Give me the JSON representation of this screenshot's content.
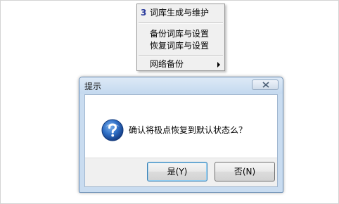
{
  "menu": {
    "items": [
      {
        "number": "3",
        "label": "词库生成与维护"
      },
      {
        "label": "备份词库与设置"
      },
      {
        "label": "恢复词库与设置"
      },
      {
        "label": "网络备份"
      }
    ]
  },
  "dialog": {
    "title": "提示",
    "message": "确认将极点恢复到默认状态么？",
    "buttons": {
      "yes": "是(Y)",
      "no": "否(N)"
    }
  },
  "icons": {
    "question": "question-icon",
    "close": "close-icon",
    "submenu": "submenu-arrow-icon"
  },
  "colors": {
    "accent": "#2b3b9c",
    "title_bar": "#c9dcf0",
    "icon_blue": "#1f5db4"
  }
}
